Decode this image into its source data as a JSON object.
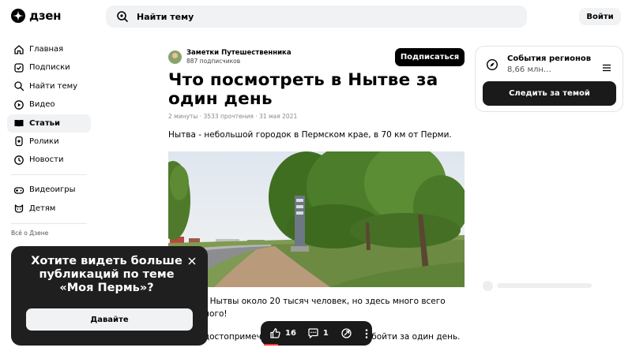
{
  "header": {
    "logo_text": "дзен",
    "search_placeholder": "Найти тему",
    "login_label": "Войти"
  },
  "sidebar": {
    "items": [
      {
        "label": "Главная",
        "icon": "home-icon"
      },
      {
        "label": "Подписки",
        "icon": "subscriptions-icon"
      },
      {
        "label": "Найти тему",
        "icon": "find-topic-icon"
      },
      {
        "label": "Видео",
        "icon": "video-icon"
      },
      {
        "label": "Статьи",
        "icon": "articles-icon",
        "active": true
      },
      {
        "label": "Ролики",
        "icon": "clips-icon"
      },
      {
        "label": "Новости",
        "icon": "news-icon"
      }
    ],
    "items2": [
      {
        "label": "Видеоигры",
        "icon": "gamepad-icon"
      },
      {
        "label": "Детям",
        "icon": "kids-icon"
      }
    ],
    "about": "Всё о Дзене"
  },
  "article": {
    "author_name": "Заметки Путешественника",
    "author_subs": "887 подписчиков",
    "subscribe_label": "Подписаться",
    "title": "Что посмотреть в Нытве за один день",
    "meta": "2 минуты · 3533 прочтения · 31 мая 2021",
    "lead": "Нытва - небольшой городок в Пермском крае, в 70 км от Перми.",
    "para1_line1": "В городе Нытвы около 20 тысяч человек, но здесь много всего",
    "para1_line2": "интересного!",
    "para2": "Вот все достопримечательности, что можно обойти за один день."
  },
  "theme": {
    "name": "События регионов",
    "count": "8,66 млн…",
    "follow_label": "Следить за темой"
  },
  "popup": {
    "title": "Хотите видеть больше публикаций по теме «Моя Пермь»?",
    "button_label": "Давайте"
  },
  "reactions": {
    "likes": "16",
    "comments": "1"
  },
  "colors": {
    "accent_dark": "#1a1a1a",
    "surface": "#f1f2f4",
    "progress_red": "#ff3b30"
  }
}
